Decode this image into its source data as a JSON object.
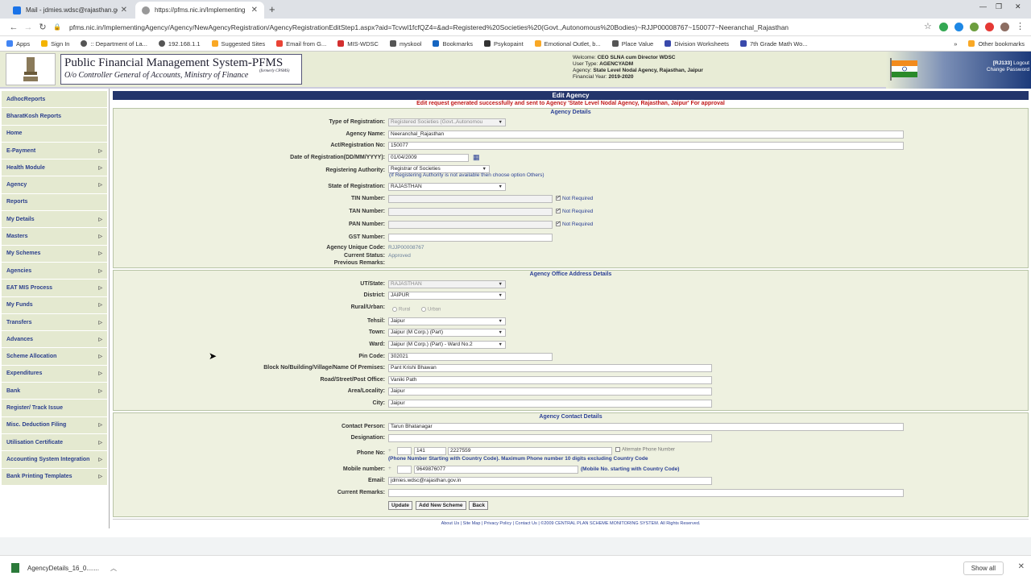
{
  "browser": {
    "tabs": [
      {
        "title": "Mail - jdmies.wdsc@rajasthan.go"
      },
      {
        "title": "https://pfms.nic.in/Implementing"
      }
    ],
    "url": "pfms.nic.in/ImplementingAgency/Agency/NewAgencyRegistration/AgencyRegistrationEditStep1.aspx?aid=Tcvwl1fcfQZ4=&ad=Registered%20Societies%20(Govt.,Autonomous%20Bodies)~RJJP00008767~150077~Neeranchal_Rajasthan",
    "bookmarks": [
      "Apps",
      "Sign In",
      ":: Department of La...",
      "192.168.1.1",
      "Suggested Sites",
      "Email from G...",
      "MIS-WDSC",
      "myskool",
      "Bookmarks",
      "Psykopaint",
      "Emotional Outlet, b...",
      "Place Value",
      "Division Worksheets",
      "7th Grade Math Wo..."
    ],
    "other_bookmarks": "Other bookmarks"
  },
  "header": {
    "title": "Public Financial Management System-PFMS",
    "formerly": "(formerly CPSMS)",
    "subtitle": "O/o Controller General of Accounts, Ministry of Finance",
    "welcome_label": "Welcome:",
    "welcome_value": "CEO SLNA cum Director WDSC",
    "usertype_label": "User Type:",
    "usertype_value": "AGENCYADM",
    "agency_label": "Agency:",
    "agency_value": "State Level Nodal Agency, Rajasthan, Jaipur",
    "fy_label": "Financial Year:",
    "fy_value": "2019-2020",
    "user_code": "[RJ133]",
    "logout": "Logout",
    "change_password": "Change Password"
  },
  "sidebar": {
    "items": [
      "AdhocReports",
      "BharatKosh Reports",
      "Home",
      "E-Payment",
      "Health Module",
      "Agency",
      "Reports",
      "My Details",
      "Masters",
      "My Schemes",
      "Agencies",
      "EAT MIS Process",
      "My Funds",
      "Transfers",
      "Advances",
      "Scheme Allocation",
      "Expenditures",
      "Bank",
      "Register/ Track Issue",
      "Misc. Deduction Filing",
      "Utilisation Certificate",
      "Accounting System Integration",
      "Bank Printing Templates"
    ],
    "has_arrow": [
      false,
      false,
      false,
      true,
      true,
      true,
      false,
      true,
      true,
      true,
      true,
      true,
      true,
      true,
      true,
      true,
      true,
      true,
      false,
      true,
      true,
      true,
      true
    ]
  },
  "page": {
    "heading": "Edit Agency",
    "message": "Edit request generated successfully and sent to Agency 'State Level Nodal Agency, Rajasthan, Jaipur' For approval",
    "agency_details": {
      "title": "Agency Details",
      "type_label": "Type of Registration:",
      "type_value": "Registered Societies (Govt.,Autonomou",
      "name_label": "Agency Name:",
      "name_value": "Neeranchal_Rajasthan",
      "act_label": "Act/Registration No:",
      "act_value": "150077",
      "date_label": "Date of Registration(DD/MM/YYYY):",
      "date_value": "01/04/2009",
      "authority_label": "Registering Authority:",
      "authority_value": "Registrar of Societies",
      "authority_note": "(If Registering Authority is not available then choose option Others)",
      "state_label": "State of Registration:",
      "state_value": "RAJASTHAN",
      "tin_label": "TIN Number:",
      "tan_label": "TAN Number:",
      "pan_label": "PAN Number:",
      "gst_label": "GST Number:",
      "not_required": "Not Required",
      "code_label": "Agency Unique Code:",
      "code_value": "RJJP00008767",
      "status_label": "Current Status:",
      "status_value": "Approved",
      "remarks_label": "Previous Remarks:"
    },
    "office": {
      "title": "Agency Office Address Details",
      "ut_label": "UT/State:",
      "ut_value": "RAJASTHAN",
      "district_label": "District:",
      "district_value": "JAIPUR",
      "rural_label": "Rural/Urban:",
      "rural": "Rural",
      "urban": "Urban",
      "tehsil_label": "Tehsil:",
      "tehsil_value": "Jaipur",
      "town_label": "Town:",
      "town_value": "Jaipur (M Corp.) (Part)",
      "ward_label": "Ward:",
      "ward_value": "Jaipur (M Corp.) (Part) - Ward No.2",
      "pin_label": "Pin Code:",
      "pin_value": "302021",
      "block_label": "Block No/Building/Village/Name Of Premises:",
      "block_value": "Pant Krishi Bhawan",
      "road_label": "Road/Street/Post Office:",
      "road_value": "Vaniki Path",
      "area_label": "Area/Locality:",
      "area_value": "Jaipur",
      "city_label": "City:",
      "city_value": "Jaipur"
    },
    "contact": {
      "title": "Agency Contact Details",
      "person_label": "Contact Person:",
      "person_value": "Tarun Bhatanagar",
      "designation_label": "Designation:",
      "phone_label": "Phone No:",
      "plus": "+",
      "phone_std": "141",
      "phone_num": "2227559",
      "alt_phone": "Alternate Phone Number",
      "phone_note": "(Phone Number Starting with Country Code). Maximum Phone number 10 digits excluding Country Code",
      "mobile_label": "Mobile number:",
      "mobile_value": "9649876077",
      "mobile_note": "(Mobile No. starting with Country Code)",
      "email_label": "Email:",
      "email_value": "jdmies.wdsc@rajasthan.gov.in",
      "remarks_label": "Current Remarks:"
    },
    "buttons": {
      "update": "Update",
      "add_scheme": "Add New Scheme",
      "back": "Back"
    },
    "footer": "About Us | Site Map | Privacy Policy | Contact Us | ©2009 CENTRAL PLAN SCHEME MONITORING SYSTEM. All Rights Reserved."
  },
  "downloads": {
    "file": "AgencyDetails_16_0.......",
    "show_all": "Show all"
  }
}
